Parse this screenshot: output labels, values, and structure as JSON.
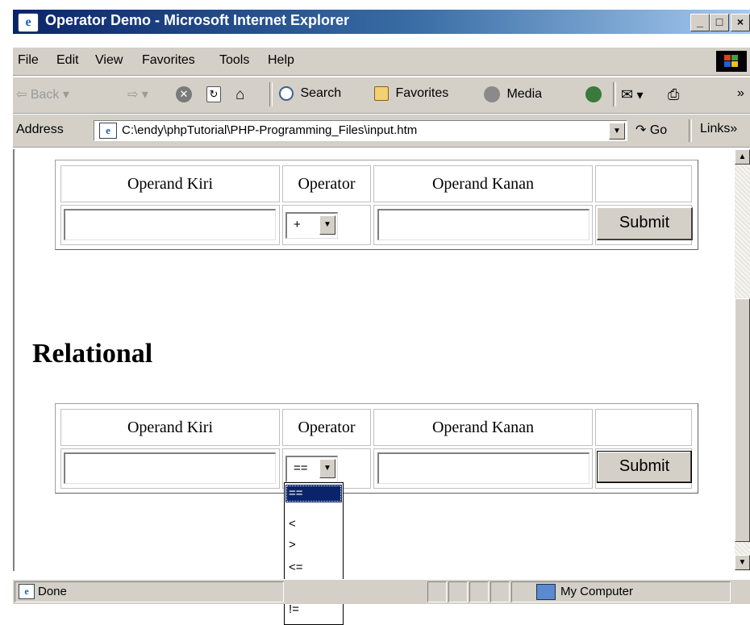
{
  "window": {
    "title": "Operator Demo - Microsoft Internet Explorer",
    "minimize": "_",
    "maximize": "□",
    "close": "×"
  },
  "menu": [
    "File",
    "Edit",
    "View",
    "Favorites",
    "Tools",
    "Help"
  ],
  "toolbar": {
    "back": "Back",
    "search": "Search",
    "favorites": "Favorites",
    "media": "Media",
    "overflow": "»"
  },
  "address": {
    "label": "Address",
    "url": "C:\\endy\\phpTutorial\\PHP-Programming_Files\\input.htm",
    "go": "Go",
    "links": "Links",
    "links_overflow": "»"
  },
  "form1": {
    "headers": [
      "Operand Kiri",
      "Operator",
      "Operand Kanan",
      ""
    ],
    "left_value": "",
    "operator_value": "+",
    "right_value": "",
    "submit": "Submit"
  },
  "section_title": "Relational",
  "form2": {
    "headers": [
      "Operand Kiri",
      "Operator",
      "Operand Kanan",
      ""
    ],
    "left_value": "",
    "operator_value": "==",
    "right_value": "",
    "submit": "Submit",
    "options": [
      "==",
      "<",
      ">",
      "<=",
      ">=",
      "!="
    ],
    "selected_index": 0
  },
  "status": {
    "text": "Done",
    "zone": "My Computer"
  },
  "colors": {
    "title_gradient_start": "#0a246a",
    "title_gradient_end": "#a6caf0",
    "chrome": "#d4d0c8",
    "selection": "#0a246a"
  }
}
